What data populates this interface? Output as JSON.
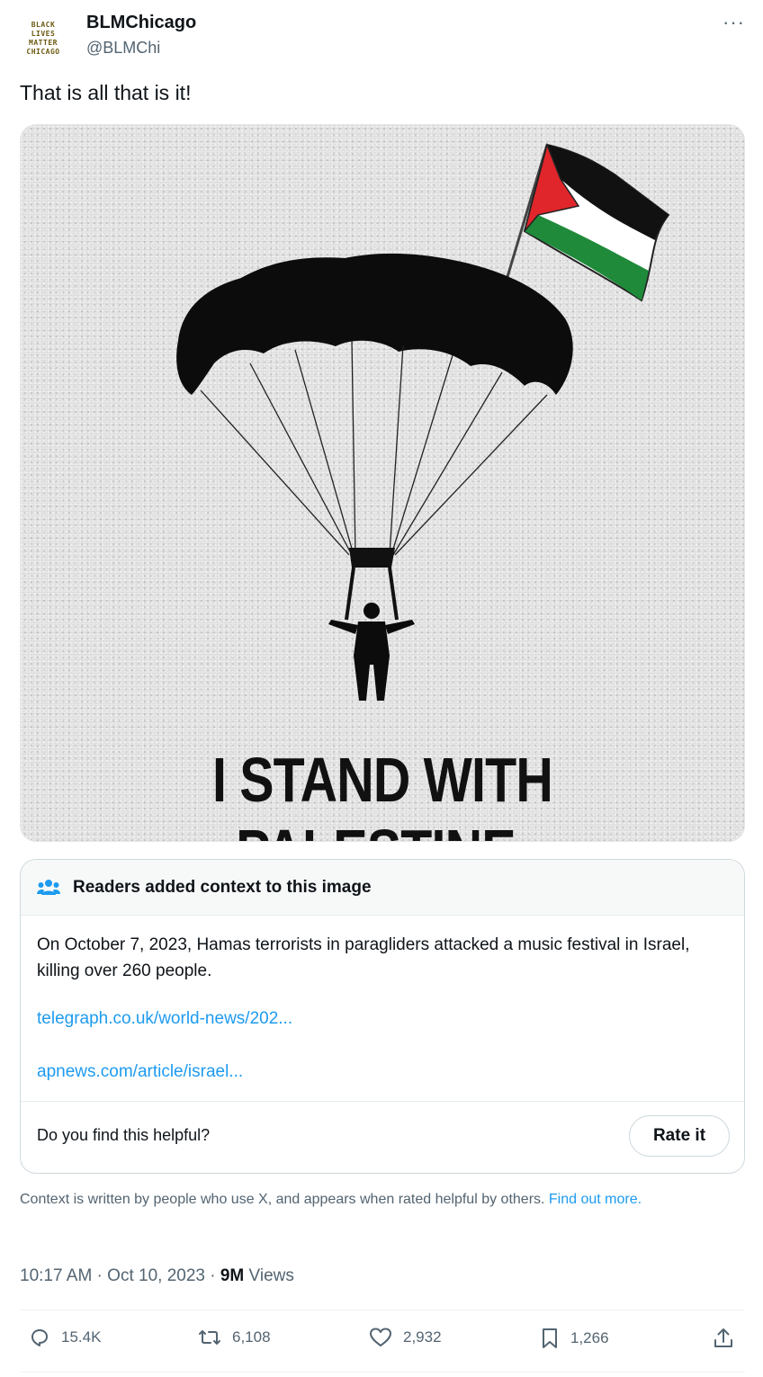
{
  "author": {
    "avatar_lines": [
      "BLACK",
      "LIVES",
      "MATTER",
      "CHICAGO"
    ],
    "name": "BLMChicago",
    "handle": "@BLMChi",
    "more": "···"
  },
  "tweet": {
    "text": "That is all that is it!"
  },
  "media": {
    "caption": "I STAND WITH PALESTINE."
  },
  "community_note": {
    "title": "Readers added context to this image",
    "body": "On October 7, 2023, Hamas terrorists in paragliders attacked a music festival in Israel, killing over 260 people.",
    "links": [
      "telegraph.co.uk/world-news/202...",
      "apnews.com/article/israel..."
    ],
    "helpful_question": "Do you find this helpful?",
    "rate_label": "Rate it"
  },
  "disclaimer": {
    "text": "Context is written by people who use X, and appears when rated helpful by others. ",
    "link": "Find out more."
  },
  "meta": {
    "time": "10:17 AM · Oct 10, 2023 · ",
    "views_count": "9M",
    "views_label": " Views"
  },
  "actions": {
    "replies": "15.4K",
    "reposts": "6,108",
    "likes": "2,932",
    "bookmarks": "1,266"
  },
  "colors": {
    "link": "#1d9bf0",
    "secondary_text": "#536471",
    "flag_red": "#e0262b",
    "flag_green": "#1f8a3a"
  }
}
